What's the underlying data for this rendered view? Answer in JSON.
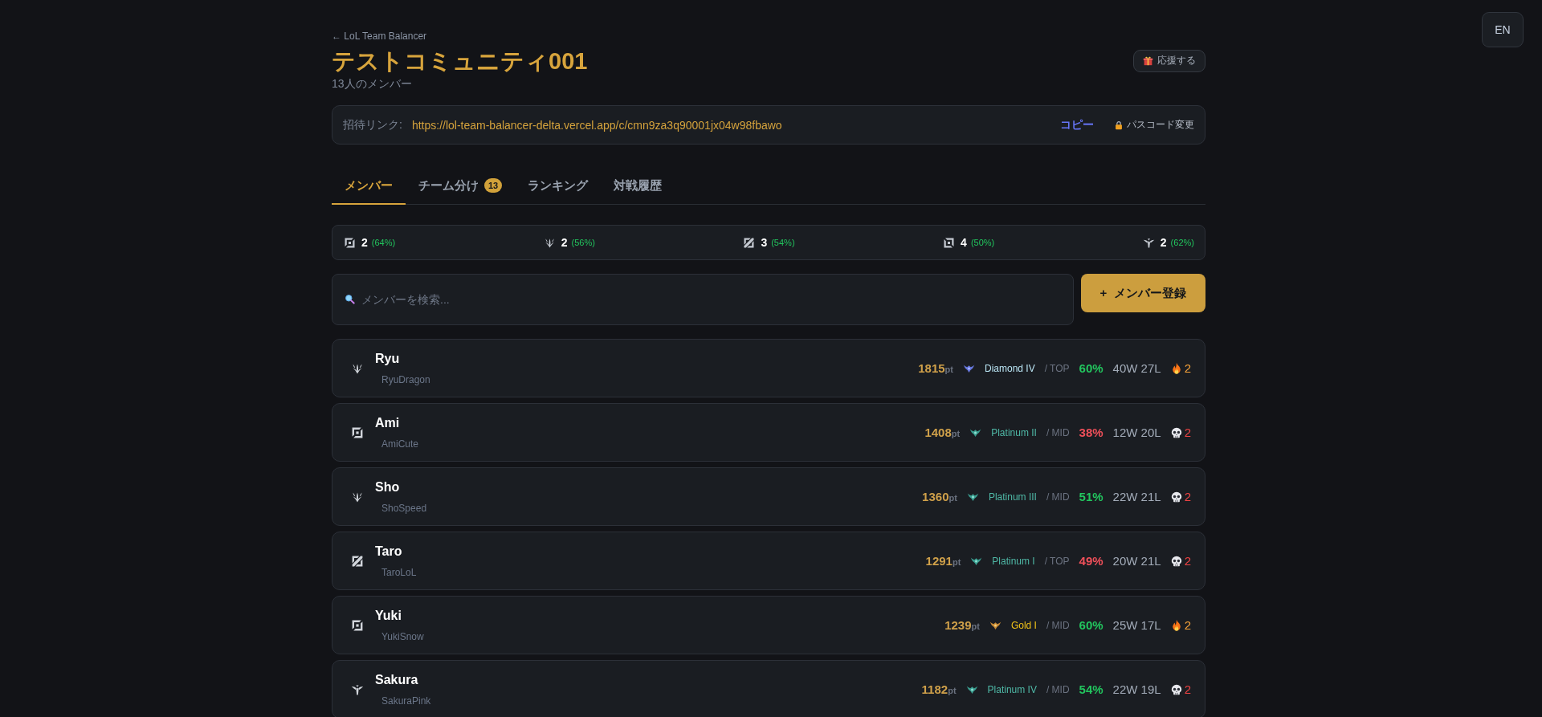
{
  "language_button": "EN",
  "header": {
    "back_link": "← LoL Team Balancer",
    "title": "テストコミュニティ001",
    "member_count": "13人のメンバー",
    "support_button": "応援する"
  },
  "invite": {
    "label": "招待リンク:",
    "url": "https://lol-team-balancer-delta.vercel.app/c/cmn9za3q90001jx04w98fbawo",
    "copy_button": "コピー",
    "passcode_button": "パスコード変更"
  },
  "tabs": [
    {
      "label": "メンバー",
      "selected": true
    },
    {
      "label": "チーム分け",
      "badge": "13",
      "selected": false
    },
    {
      "label": "ランキング",
      "selected": false
    },
    {
      "label": "対戦履歴",
      "selected": false
    }
  ],
  "role_stats": [
    {
      "kind": "top",
      "count": "2",
      "percent": "(64%)"
    },
    {
      "kind": "jungle",
      "count": "2",
      "percent": "(56%)"
    },
    {
      "kind": "mid",
      "count": "3",
      "percent": "(54%)"
    },
    {
      "kind": "bot",
      "count": "4",
      "percent": "(50%)"
    },
    {
      "kind": "support",
      "count": "2",
      "percent": "(62%)"
    }
  ],
  "search": {
    "placeholder": "メンバーを検索..."
  },
  "add_button": "+ メンバー登録",
  "members": [
    {
      "role_icon": {
        "kind": "jungle"
      },
      "name": "Ryu",
      "summoner": "RyuDragon",
      "points": "**1815**pt",
      "rank": {
        "kind": "diamond",
        "label": "Diamond IV"
      },
      "lane": "/ TOP",
      "winrate": "60%",
      "winrate_good": true,
      "record": "40W 27L",
      "streak": {
        "kind": "win",
        "count": "2"
      }
    },
    {
      "role_icon": {
        "kind": "top"
      },
      "name": "Ami",
      "summoner": "AmiCute",
      "points": "**1408**pt",
      "rank": {
        "kind": "platinum",
        "label": "Platinum II"
      },
      "lane": "/ MID",
      "winrate": "38%",
      "winrate_good": false,
      "record": "12W 20L",
      "streak": {
        "kind": "loss",
        "count": "2"
      }
    },
    {
      "role_icon": {
        "kind": "jungle"
      },
      "name": "Sho",
      "summoner": "ShoSpeed",
      "points": "**1360**pt",
      "rank": {
        "kind": "platinum",
        "label": "Platinum III"
      },
      "lane": "/ MID",
      "winrate": "51%",
      "winrate_good": true,
      "record": "22W 21L",
      "streak": {
        "kind": "loss",
        "count": "2"
      }
    },
    {
      "role_icon": {
        "kind": "mid"
      },
      "name": "Taro",
      "summoner": "TaroLoL",
      "points": "**1291**pt",
      "rank": {
        "kind": "platinum",
        "label": "Platinum I"
      },
      "lane": "/ TOP",
      "winrate": "49%",
      "winrate_good": false,
      "record": "20W 21L",
      "streak": {
        "kind": "loss",
        "count": "2"
      }
    },
    {
      "role_icon": {
        "kind": "top"
      },
      "name": "Yuki",
      "summoner": "YukiSnow",
      "points": "**1239**pt",
      "rank": {
        "kind": "gold",
        "label": "Gold I"
      },
      "lane": "/ MID",
      "winrate": "60%",
      "winrate_good": true,
      "record": "25W 17L",
      "streak": {
        "kind": "win",
        "count": "2"
      }
    },
    {
      "role_icon": {
        "kind": "support"
      },
      "name": "Sakura",
      "summoner": "SakuraPink",
      "points": "**1182**pt",
      "rank": {
        "kind": "platinum",
        "label": "Platinum IV"
      },
      "lane": "/ MID",
      "winrate": "54%",
      "winrate_good": true,
      "record": "22W 19L",
      "streak": {
        "kind": "loss",
        "count": "2"
      }
    }
  ]
}
